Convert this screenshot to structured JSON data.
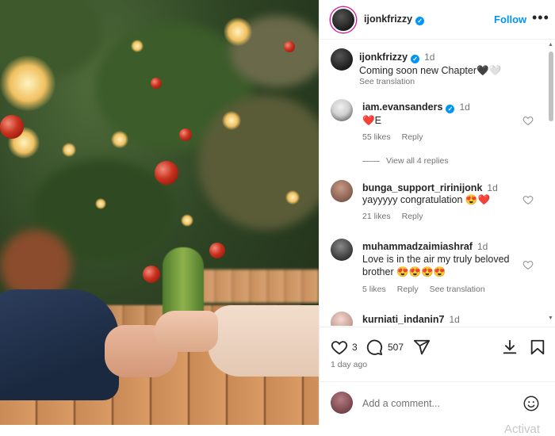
{
  "post": {
    "image_alt": "Couple holding hands at a wooden table in front of Christmas decorations",
    "author": "ijonkfrizzy",
    "follow_label": "Follow",
    "more_label": "•••",
    "caption": {
      "username": "ijonkfrizzy",
      "time": "1d",
      "text": "Coming soon new Chapter🖤🤍",
      "see_translation": "See translation"
    },
    "comments": [
      {
        "username": "iam.evansanders",
        "verified": true,
        "time": "1d",
        "text": "❤️E",
        "likes": "55 likes",
        "reply": "Reply",
        "view_replies": "View all 4 replies"
      },
      {
        "username": "bunga_support_ririnijonk",
        "verified": false,
        "time": "1d",
        "text": "yayyyyy congratulation 😍❤️",
        "likes": "21 likes",
        "reply": "Reply"
      },
      {
        "username": "muhammadzaimiashraf",
        "verified": false,
        "time": "1d",
        "text": "Love is in the air my truly beloved brother 😍😍😍😍",
        "likes": "5 likes",
        "reply": "Reply",
        "see_translation": "See translation"
      },
      {
        "username": "kurniati_indanin7",
        "verified": false,
        "time": "1d"
      }
    ],
    "actions": {
      "like_count": "3",
      "comment_count": "507",
      "posted_ago": "1 day ago"
    },
    "composer": {
      "placeholder": "Add a comment..."
    }
  },
  "icons": {
    "verified": "verified-badge-icon",
    "heart": "heart-icon",
    "comment": "comment-icon",
    "share": "share-icon",
    "download": "download-icon",
    "save": "bookmark-icon",
    "emoji": "emoji-icon"
  },
  "colors": {
    "accent": "#0095f6",
    "text": "#262626",
    "muted": "#737373"
  },
  "watermark": "Activat"
}
